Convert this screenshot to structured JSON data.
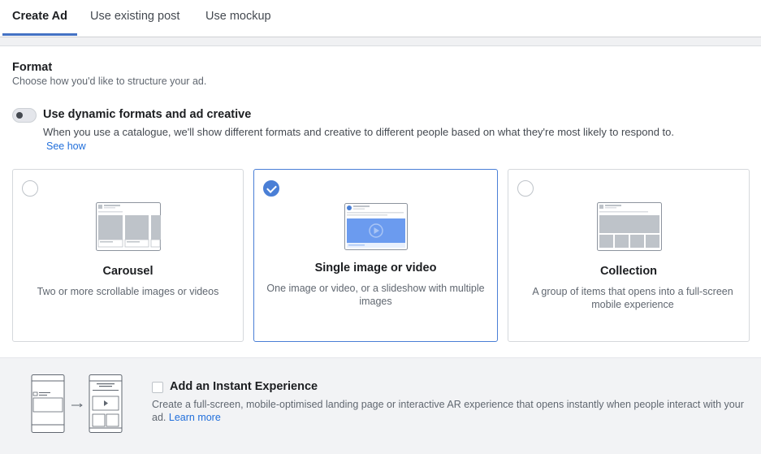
{
  "tabs": [
    {
      "label": "Create Ad",
      "active": true
    },
    {
      "label": "Use existing post",
      "active": false
    },
    {
      "label": "Use mockup",
      "active": false
    }
  ],
  "format": {
    "title": "Format",
    "subtitle": "Choose how you'd like to structure your ad."
  },
  "dynamic": {
    "title": "Use dynamic formats and ad creative",
    "description": "When you use a catalogue, we'll show different formats and creative to different people based on what they're most likely to respond to.",
    "link": "See how",
    "enabled": false
  },
  "cards": [
    {
      "title": "Carousel",
      "description": "Two or more scrollable images or videos",
      "selected": false,
      "icon": "carousel-illustration"
    },
    {
      "title": "Single image or video",
      "description": "One image or video, or a slideshow with multiple images",
      "selected": true,
      "icon": "single-image-illustration"
    },
    {
      "title": "Collection",
      "description": "A group of items that opens into a full-screen mobile experience",
      "selected": false,
      "icon": "collection-illustration"
    }
  ],
  "instant_experience": {
    "title": "Add an Instant Experience",
    "description": "Create a full-screen, mobile-optimised landing page or interactive AR experience that opens instantly when people interact with your ad.",
    "link": "Learn more",
    "checked": false
  },
  "colors": {
    "accent": "#4a7fd6",
    "link": "#216fdb",
    "tab_underline": "#4472c4"
  }
}
